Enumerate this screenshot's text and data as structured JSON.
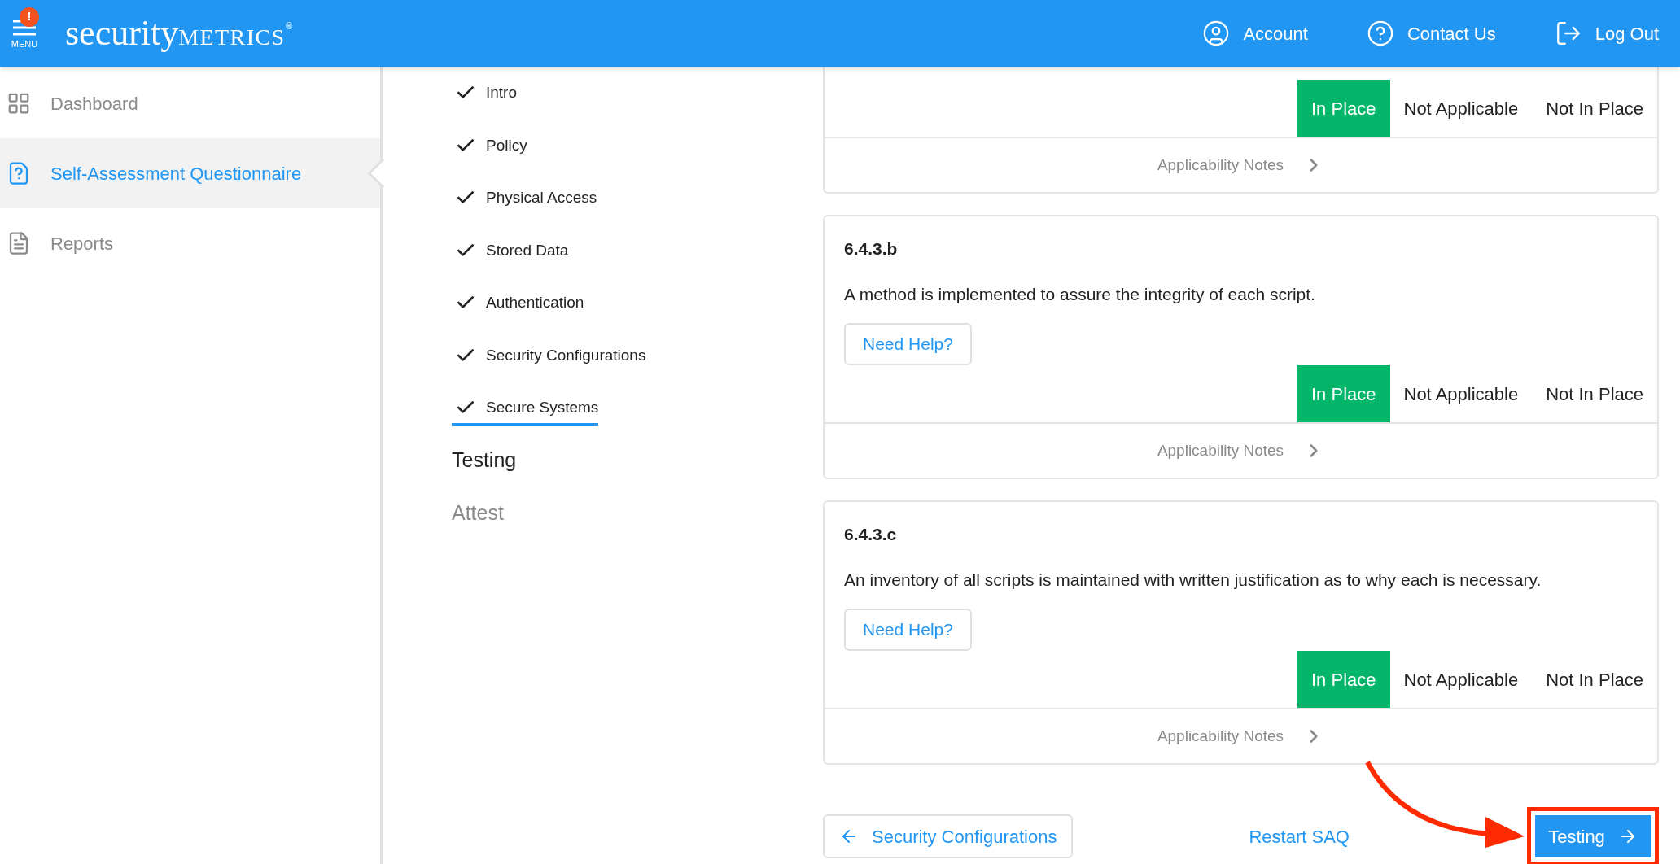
{
  "header": {
    "menu_label": "MENU",
    "alert_badge": "!",
    "logo": {
      "part1": "security",
      "part2": "METRICS",
      "mark": "®"
    },
    "actions": [
      {
        "kind": "account",
        "label": "Account"
      },
      {
        "kind": "contact",
        "label": "Contact Us"
      },
      {
        "kind": "logout",
        "label": "Log Out"
      }
    ]
  },
  "sidebar": {
    "items": [
      {
        "kind": "dashboard",
        "label": "Dashboard",
        "selected": false
      },
      {
        "kind": "questionnaire",
        "label": "Self-Assessment Questionnaire",
        "selected": true
      },
      {
        "kind": "reports",
        "label": "Reports",
        "selected": false
      }
    ]
  },
  "steps": [
    {
      "label": "Intro",
      "done": true,
      "selected": false,
      "disabled": false
    },
    {
      "label": "Policy",
      "done": true,
      "selected": false,
      "disabled": false
    },
    {
      "label": "Physical Access",
      "done": true,
      "selected": false,
      "disabled": false
    },
    {
      "label": "Stored Data",
      "done": true,
      "selected": false,
      "disabled": false
    },
    {
      "label": "Authentication",
      "done": true,
      "selected": false,
      "disabled": false
    },
    {
      "label": "Security Configurations",
      "done": true,
      "selected": false,
      "disabled": false
    },
    {
      "label": "Secure Systems",
      "done": true,
      "selected": true,
      "disabled": false
    },
    {
      "label": "Testing",
      "done": false,
      "selected": false,
      "disabled": false
    },
    {
      "label": "Attest",
      "done": false,
      "selected": false,
      "disabled": true
    }
  ],
  "requirements": [
    {
      "options": [
        {
          "label": "In Place",
          "selected": true
        },
        {
          "label": "Not Applicable",
          "selected": false
        },
        {
          "label": "Not In Place",
          "selected": false
        }
      ],
      "notes": "Applicability Notes"
    },
    {
      "id": "6.4.3.b",
      "text": "A method is implemented to assure the integrity of each script.",
      "help": "Need Help?",
      "options": [
        {
          "label": "In Place",
          "selected": true
        },
        {
          "label": "Not Applicable",
          "selected": false
        },
        {
          "label": "Not In Place",
          "selected": false
        }
      ],
      "notes": "Applicability Notes"
    },
    {
      "id": "6.4.3.c",
      "text": "An inventory of all scripts is maintained with written justification as to why each is necessary.",
      "help": "Need Help?",
      "options": [
        {
          "label": "In Place",
          "selected": true
        },
        {
          "label": "Not Applicable",
          "selected": false
        },
        {
          "label": "Not In Place",
          "selected": false
        }
      ],
      "notes": "Applicability Notes"
    }
  ],
  "footer": {
    "back": "Security Configurations",
    "restart": "Restart SAQ",
    "next": "Testing",
    "next_highlighted": true
  }
}
